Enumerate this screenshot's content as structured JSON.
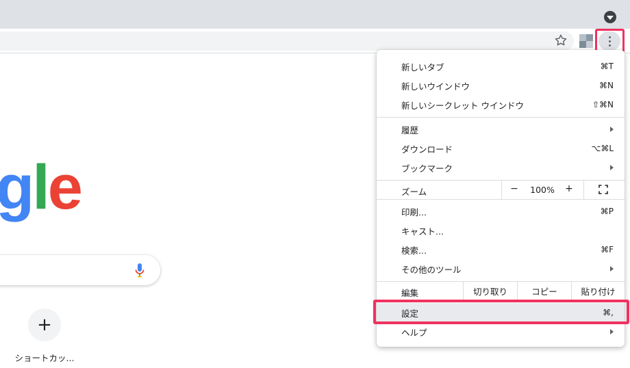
{
  "logo": {
    "c1": "g",
    "c2": "l",
    "c3": "e"
  },
  "shortcut": {
    "add_glyph": "+",
    "label": "ショートカッ..."
  },
  "menu": {
    "new_tab": {
      "label": "新しいタブ",
      "shortcut": "⌘T"
    },
    "new_window": {
      "label": "新しいウインドウ",
      "shortcut": "⌘N"
    },
    "new_incognito": {
      "label": "新しいシークレット ウインドウ",
      "shortcut": "⇧⌘N"
    },
    "history": {
      "label": "履歴"
    },
    "downloads": {
      "label": "ダウンロード",
      "shortcut": "⌥⌘L"
    },
    "bookmarks": {
      "label": "ブックマーク"
    },
    "zoom": {
      "label": "ズーム",
      "minus": "−",
      "value": "100%",
      "plus": "+"
    },
    "print": {
      "label": "印刷...",
      "shortcut": "⌘P"
    },
    "cast": {
      "label": "キャスト..."
    },
    "find": {
      "label": "検索...",
      "shortcut": "⌘F"
    },
    "more_tools": {
      "label": "その他のツール"
    },
    "edit": {
      "label": "編集",
      "cut": "切り取り",
      "copy": "コピー",
      "paste": "貼り付け"
    },
    "settings": {
      "label": "設定",
      "shortcut": "⌘,"
    },
    "help": {
      "label": "ヘルプ"
    }
  },
  "colors": {
    "highlight": "#f0325f",
    "google_blue": "#4285f4",
    "google_green": "#34a853",
    "google_red": "#ea4335"
  },
  "icons": [
    "tab-search-icon",
    "star-icon",
    "extension-icon",
    "menu-dots-icon",
    "mic-icon",
    "plus-icon",
    "fullscreen-icon",
    "chevron-right-icon"
  ]
}
